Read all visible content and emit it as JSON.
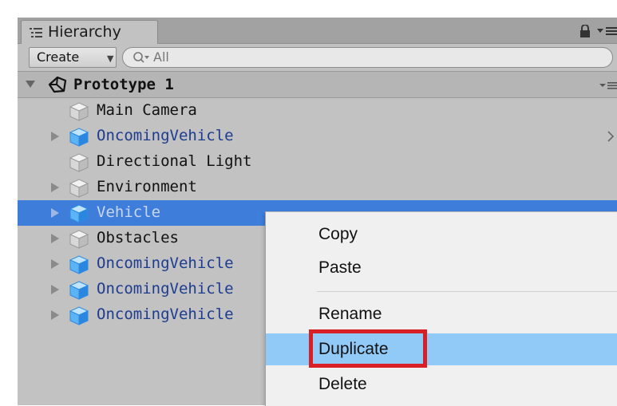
{
  "window": {
    "tab_title": "Hierarchy",
    "create_label": "Create",
    "search_placeholder": "All"
  },
  "scene": {
    "name": "Prototype 1"
  },
  "hierarchy": {
    "items": [
      {
        "label": "Main Camera",
        "prefab": false,
        "expandable": false,
        "selected": false
      },
      {
        "label": "OncomingVehicle",
        "prefab": true,
        "expandable": true,
        "selected": false
      },
      {
        "label": "Directional Light",
        "prefab": false,
        "expandable": false,
        "selected": false
      },
      {
        "label": "Environment",
        "prefab": false,
        "expandable": true,
        "selected": false
      },
      {
        "label": "Vehicle",
        "prefab": true,
        "expandable": true,
        "selected": true
      },
      {
        "label": "Obstacles",
        "prefab": false,
        "expandable": true,
        "selected": false
      },
      {
        "label": "OncomingVehicle",
        "prefab": true,
        "expandable": true,
        "selected": false
      },
      {
        "label": "OncomingVehicle",
        "prefab": true,
        "expandable": true,
        "selected": false
      },
      {
        "label": "OncomingVehicle",
        "prefab": true,
        "expandable": true,
        "selected": false
      }
    ]
  },
  "context_menu": {
    "items": [
      {
        "label": "Copy"
      },
      {
        "label": "Paste"
      },
      {
        "label": "Rename"
      },
      {
        "label": "Duplicate",
        "highlighted": true
      },
      {
        "label": "Delete"
      }
    ]
  },
  "colors": {
    "selection": "#3f7ddb",
    "menu_highlight": "#91c9f7",
    "annotation_box": "#d81f26",
    "prefab_text": "#1d3b8f"
  },
  "icons": {
    "tab": "list-icon",
    "lock": "lock-icon",
    "panel_menu": "menu-icon",
    "scene": "unity-logo-icon",
    "object": "cube-icon"
  }
}
